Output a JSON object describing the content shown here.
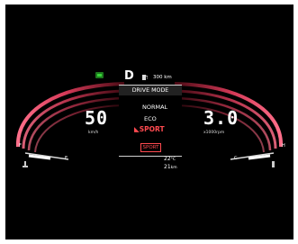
{
  "gear": "D",
  "range": {
    "value": "300",
    "unit": "km"
  },
  "drive_mode": {
    "title": "DRIVE MODE",
    "options": [
      "NORMAL",
      "ECO",
      "SPORT"
    ],
    "selected": "SPORT",
    "badge": "SPORT"
  },
  "speed": {
    "value": "50",
    "unit": "km/h"
  },
  "tachometer": {
    "value": "3.0",
    "unit": "x1000rpm"
  },
  "temp_gauge": {
    "full": "F",
    "empty": "E"
  },
  "fuel_gauge": {
    "cold": "C",
    "hot": "H"
  },
  "outside_temp": {
    "value": "22",
    "unit": "°C"
  },
  "trip_distance": {
    "value": "21",
    "unit": "km"
  },
  "icons": [
    "headlight-indicator-icon",
    "fuel-pump-icon",
    "coolant-temp-icon"
  ],
  "colors": {
    "accent": "#ff4a50",
    "arc_dark": "#5a0e1c",
    "arc_light": "#e84764",
    "indicator_green": "#33cc33"
  }
}
